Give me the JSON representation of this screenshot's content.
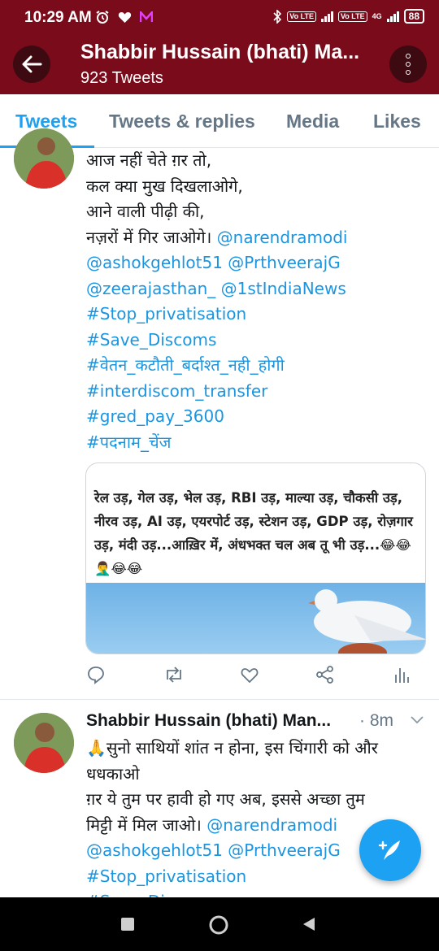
{
  "status_bar": {
    "time": "10:29 AM",
    "volte_1": "Vo LTE",
    "volte_2": "Vo LTE",
    "network": "4G",
    "battery": "88"
  },
  "header": {
    "title": "Shabbir Hussain (bhati) Ma...",
    "tweet_count": "923 Tweets"
  },
  "tabs": [
    {
      "label": "Tweets",
      "active": true
    },
    {
      "label": "Tweets & replies",
      "active": false
    },
    {
      "label": "Media",
      "active": false
    },
    {
      "label": "Likes",
      "active": false
    }
  ],
  "tweet1": {
    "lines": [
      {
        "text": "आज नहीं चेते ग़र तो,"
      },
      {
        "text": "कल क्या मुख दिखलाओगे,"
      },
      {
        "text": "आने वाली पीढ़ी की,"
      },
      {
        "text": "नज़रों में गिर जाओगे। ",
        "link": "@narendramodi"
      },
      {
        "link": "@ashokgehlot51 @PrthveerajG"
      },
      {
        "link": "@zeerajasthan_ @1stIndiaNews"
      },
      {
        "link": "#Stop_privatisation"
      },
      {
        "link": "#Save_Discoms"
      },
      {
        "link": "#वेतन_कटौती_बर्दाश्त_नही_होगी"
      },
      {
        "link": "#interdiscom_transfer"
      },
      {
        "link": "#gred_pay_3600"
      },
      {
        "link": "#पदनाम_चेंज"
      }
    ],
    "media_text": "रेल उड़, गेल उड़, भेल उड़, RBI उड़, माल्या उड़, चौकसी उड़, नीरव उड़, AI उड़, एयरपोर्ट उड़, स्टेशन उड़, GDP उड़, रोज़गार उड़, मंदी उड़...आख़िर में, अंधभक्त चल अब तू भी उड़...😂😂🤦‍♂️😂😂"
  },
  "tweet2": {
    "author": "Shabbir Hussain (bhati) Man...",
    "time": "· 8m",
    "lines": [
      {
        "text": "🙏सुनो साथियों शांत न होना, इस चिंगारी को और"
      },
      {
        "text": "धधकाओ"
      },
      {
        "text": "ग़र ये तुम पर हावी हो गए अब, इससे अच्छा तुम"
      },
      {
        "text": "मिट्टी में मिल जाओ। ",
        "link": "@narendramodi"
      },
      {
        "link": "@ashokgehlot51 @PrthveerajG"
      },
      {
        "link": "#Stop_privatisation"
      },
      {
        "link": "#Save_Discoms"
      }
    ]
  },
  "colors": {
    "header_bg": "#7a0b1b",
    "accent": "#1da1f2",
    "link": "#1b95e0"
  }
}
